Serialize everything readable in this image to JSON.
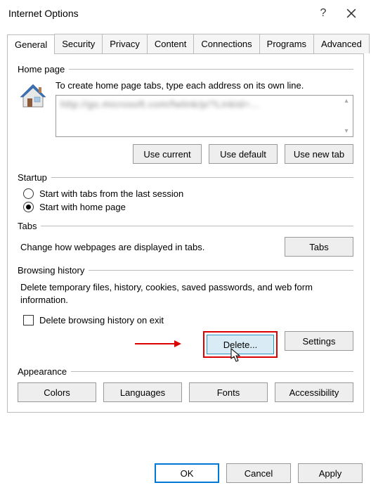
{
  "window": {
    "title": "Internet Options"
  },
  "tabs": {
    "items": [
      {
        "label": "General"
      },
      {
        "label": "Security"
      },
      {
        "label": "Privacy"
      },
      {
        "label": "Content"
      },
      {
        "label": "Connections"
      },
      {
        "label": "Programs"
      },
      {
        "label": "Advanced"
      }
    ],
    "active_index": 0
  },
  "homepage": {
    "group_label": "Home page",
    "description": "To create home page tabs, type each address on its own line.",
    "url_value": "http://go.microsoft.com/fwlink/p/?LinkId=...",
    "buttons": {
      "use_current": "Use current",
      "use_default": "Use default",
      "use_new_tab": "Use new tab"
    }
  },
  "startup": {
    "group_label": "Startup",
    "option_last_session": "Start with tabs from the last session",
    "option_home_page": "Start with home page",
    "selected": "home_page"
  },
  "tabs_section": {
    "group_label": "Tabs",
    "description": "Change how webpages are displayed in tabs.",
    "button": "Tabs"
  },
  "browsing_history": {
    "group_label": "Browsing history",
    "description": "Delete temporary files, history, cookies, saved passwords, and web form information.",
    "checkbox_label": "Delete browsing history on exit",
    "checkbox_checked": false,
    "delete_button": "Delete...",
    "settings_button": "Settings"
  },
  "appearance": {
    "group_label": "Appearance",
    "buttons": {
      "colors": "Colors",
      "languages": "Languages",
      "fonts": "Fonts",
      "accessibility": "Accessibility"
    }
  },
  "footer": {
    "ok": "OK",
    "cancel": "Cancel",
    "apply": "Apply"
  }
}
